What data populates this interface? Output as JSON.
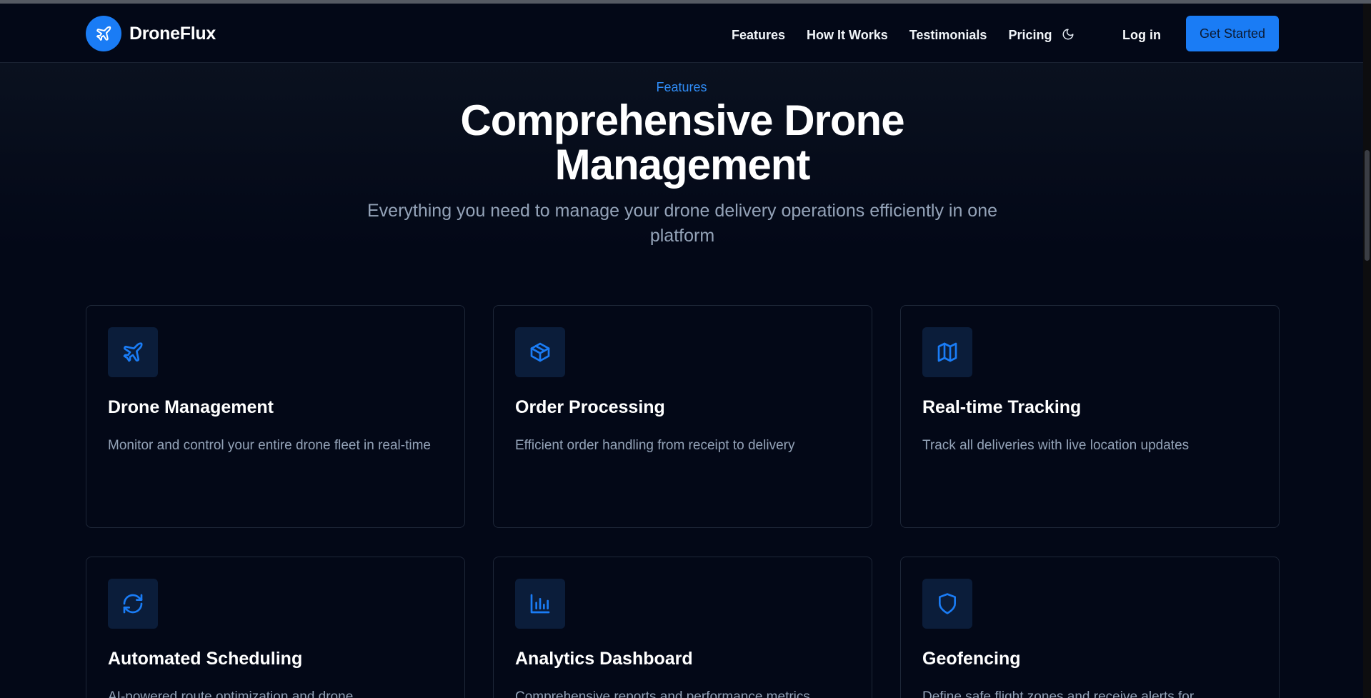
{
  "brand": {
    "name": "DroneFlux",
    "logo_icon": "plane-icon",
    "accent": "#1a7cf5"
  },
  "nav": {
    "links": [
      "Features",
      "How It Works",
      "Testimonials",
      "Pricing"
    ],
    "theme_icon": "moon-icon",
    "login_label": "Log in",
    "cta_label": "Get Started"
  },
  "section": {
    "eyebrow": "Features",
    "headline": "Comprehensive Drone Management",
    "subtitle": "Everything you need to manage your drone delivery operations efficiently in one platform"
  },
  "features": [
    {
      "icon": "plane-icon",
      "title": "Drone Management",
      "description": "Monitor and control your entire drone fleet in real-time"
    },
    {
      "icon": "package-icon",
      "title": "Order Processing",
      "description": "Efficient order handling from receipt to delivery"
    },
    {
      "icon": "map-icon",
      "title": "Real-time Tracking",
      "description": "Track all deliveries with live location updates"
    },
    {
      "icon": "refresh-icon",
      "title": "Automated Scheduling",
      "description": "AI-powered route optimization and drone"
    },
    {
      "icon": "bar-chart-icon",
      "title": "Analytics Dashboard",
      "description": "Comprehensive reports and performance metrics"
    },
    {
      "icon": "shield-icon",
      "title": "Geofencing",
      "description": "Define safe flight zones and receive alerts for"
    }
  ]
}
